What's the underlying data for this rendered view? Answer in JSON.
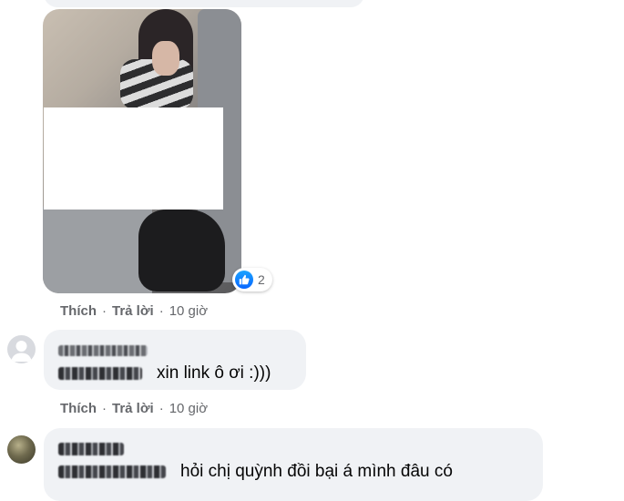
{
  "post": {
    "reaction": {
      "icon": "like-icon",
      "count": "2",
      "color": "#0866ff"
    }
  },
  "comments": [
    {
      "actions": {
        "like": "Thích",
        "reply": "Trả lời",
        "time": "10 giờ"
      }
    },
    {
      "text": "xin link ô ơi :)))",
      "actions": {
        "like": "Thích",
        "reply": "Trả lời",
        "time": "10 giờ"
      }
    },
    {
      "text": "hỏi chị quỳnh đồi bại á mình đâu có"
    }
  ],
  "colors": {
    "bubble": "#f0f2f5",
    "secondary_text": "#65676b",
    "accent": "#0866ff"
  }
}
